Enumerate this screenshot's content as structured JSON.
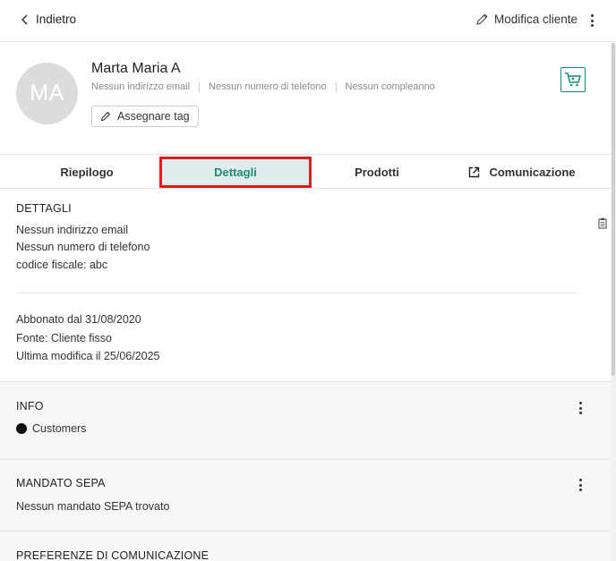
{
  "header": {
    "back_label": "Indietro",
    "edit_label": "Modifica cliente"
  },
  "profile": {
    "initials": "MA",
    "name": "Marta Maria A",
    "email": "Nessun indirizzo email",
    "phone": "Nessun numero di telefono",
    "birthday": "Nessun compleanno",
    "tag_button": "Assegnare tag"
  },
  "tabs": [
    {
      "label": "Riepilogo"
    },
    {
      "label": "Dettagli",
      "active": true
    },
    {
      "label": "Prodotti"
    },
    {
      "label": "Comunicazione"
    }
  ],
  "details": {
    "title": "DETTAGLI",
    "lines": [
      "Nessun indirizzo email",
      "Nessun numero di telefono",
      "codice fiscale: abc"
    ],
    "subscribed": "Abbonato dal 31/08/2020",
    "source": "Fonte: Cliente fisso",
    "modified": "Ultima modifica il 25/06/2025"
  },
  "info": {
    "title": "INFO",
    "group": "Customers"
  },
  "sepa": {
    "title": "MANDATO SEPA",
    "text": "Nessun mandato SEPA trovato"
  },
  "preferences": {
    "title": "PREFERENZE DI COMUNICAZIONE"
  },
  "colors": {
    "accent": "#1a8a7c",
    "active_tab_bg": "#e1eded",
    "highlight": "#e31b1b"
  }
}
